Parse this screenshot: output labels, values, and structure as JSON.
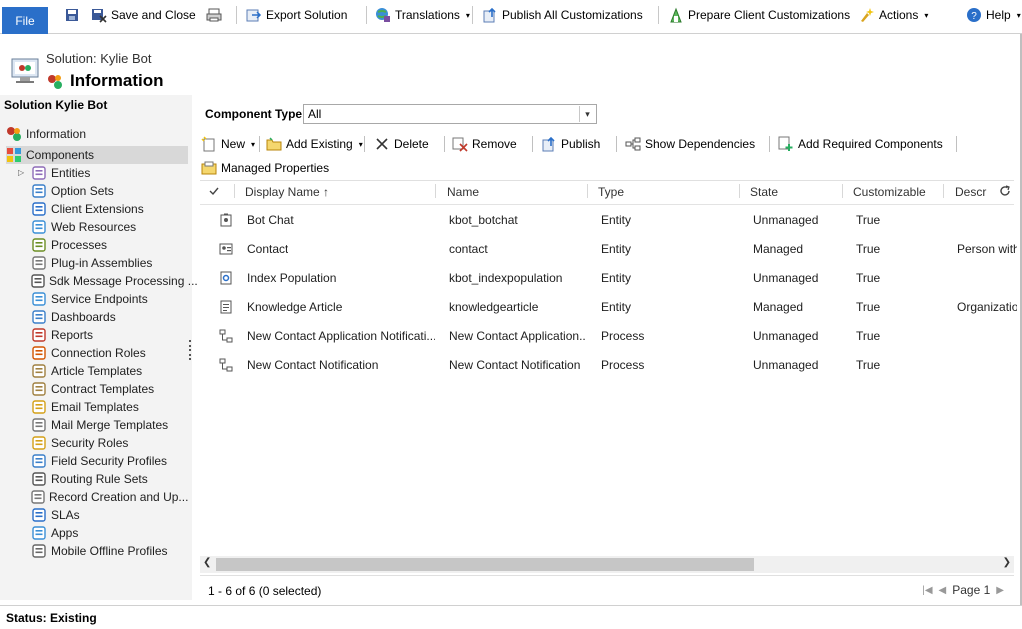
{
  "ribbon": {
    "file_label": "File",
    "save_close_label": "Save and Close",
    "export_label": "Export Solution",
    "translations_label": "Translations",
    "publish_all_label": "Publish All Customizations",
    "prepare_client_label": "Prepare Client Customizations",
    "actions_label": "Actions",
    "help_label": "Help"
  },
  "header": {
    "solution_line": "Solution: Kylie Bot",
    "title": "Information"
  },
  "sidebar": {
    "title": "Solution Kylie Bot",
    "top_items": [
      {
        "label": "Information",
        "icon": "information-icon"
      },
      {
        "label": "Components",
        "icon": "components-icon"
      }
    ],
    "items": [
      {
        "label": "Entities",
        "icon": "entities-icon"
      },
      {
        "label": "Option Sets",
        "icon": "option-sets-icon"
      },
      {
        "label": "Client Extensions",
        "icon": "client-extensions-icon"
      },
      {
        "label": "Web Resources",
        "icon": "web-resources-icon"
      },
      {
        "label": "Processes",
        "icon": "processes-icon"
      },
      {
        "label": "Plug-in Assemblies",
        "icon": "plugin-icon"
      },
      {
        "label": "Sdk Message Processing ...",
        "icon": "sdk-icon"
      },
      {
        "label": "Service Endpoints",
        "icon": "globe-icon"
      },
      {
        "label": "Dashboards",
        "icon": "dashboard-icon"
      },
      {
        "label": "Reports",
        "icon": "report-icon"
      },
      {
        "label": "Connection Roles",
        "icon": "connection-icon"
      },
      {
        "label": "Article Templates",
        "icon": "article-icon"
      },
      {
        "label": "Contract Templates",
        "icon": "contract-icon"
      },
      {
        "label": "Email Templates",
        "icon": "email-icon"
      },
      {
        "label": "Mail Merge Templates",
        "icon": "mail-merge-icon"
      },
      {
        "label": "Security Roles",
        "icon": "security-roles-icon"
      },
      {
        "label": "Field Security Profiles",
        "icon": "field-security-icon"
      },
      {
        "label": "Routing Rule Sets",
        "icon": "routing-icon"
      },
      {
        "label": "Record Creation and Up...",
        "icon": "gear-icon"
      },
      {
        "label": "SLAs",
        "icon": "sla-icon"
      },
      {
        "label": "Apps",
        "icon": "apps-icon"
      },
      {
        "label": "Mobile Offline Profiles",
        "icon": "mobile-offline-icon"
      }
    ]
  },
  "component_type": {
    "label": "Component Type",
    "value": "All"
  },
  "toolbar": {
    "new_label": "New",
    "add_existing_label": "Add Existing",
    "delete_label": "Delete",
    "remove_label": "Remove",
    "publish_label": "Publish",
    "show_dependencies_label": "Show Dependencies",
    "add_required_label": "Add Required Components",
    "managed_properties_label": "Managed Properties"
  },
  "grid": {
    "columns": [
      "Display Name",
      "Name",
      "Type",
      "State",
      "Customizable",
      "Descr"
    ],
    "sort_indicator": "↑",
    "rows": [
      {
        "display_name": "Bot Chat",
        "name": "kbot_botchat",
        "type": "Entity",
        "state": "Unmanaged",
        "customizable": "True",
        "description": "",
        "icon": "entity-icon"
      },
      {
        "display_name": "Contact",
        "name": "contact",
        "type": "Entity",
        "state": "Managed",
        "customizable": "True",
        "description": "Person with",
        "icon": "contact-card-icon"
      },
      {
        "display_name": "Index Population",
        "name": "kbot_indexpopulation",
        "type": "Entity",
        "state": "Unmanaged",
        "customizable": "True",
        "description": "",
        "icon": "entity-gear-icon"
      },
      {
        "display_name": "Knowledge Article",
        "name": "knowledgearticle",
        "type": "Entity",
        "state": "Managed",
        "customizable": "True",
        "description": "Organizatio",
        "icon": "document-icon"
      },
      {
        "display_name": "New Contact Application Notificati...",
        "name": "New Contact Application...",
        "type": "Process",
        "state": "Unmanaged",
        "customizable": "True",
        "description": "",
        "icon": "process-icon"
      },
      {
        "display_name": "New Contact Notification",
        "name": "New Contact Notification",
        "type": "Process",
        "state": "Unmanaged",
        "customizable": "True",
        "description": "",
        "icon": "process-icon"
      }
    ]
  },
  "footer": {
    "record_count": "1 - 6 of 6 (0 selected)",
    "page_label": "Page 1"
  },
  "status": {
    "text": "Status: Existing"
  }
}
